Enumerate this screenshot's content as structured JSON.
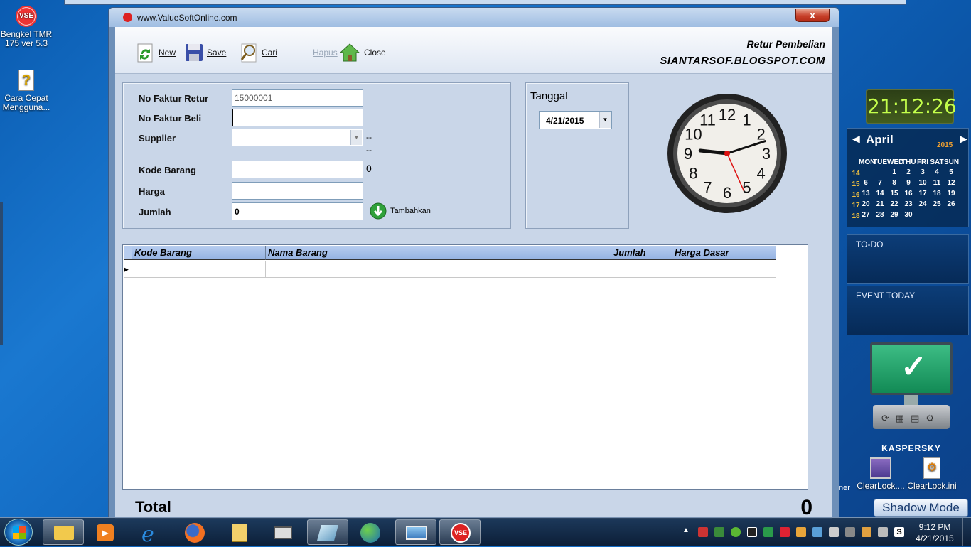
{
  "desktop": {
    "icons": [
      {
        "label": "Bengkel TMR 175 ver 5.3",
        "badge": "VSE"
      },
      {
        "label": "Cara Cepat Mengguna..."
      }
    ]
  },
  "window": {
    "title": "www.ValueSoftOnline.com",
    "close": "x"
  },
  "toolbar": {
    "new": "New",
    "save": "Save",
    "cari": "Cari",
    "hapus": "Hapus",
    "close": "Close",
    "title": "Retur Pembelian",
    "site": "SIANTARSOF.BLOGSPOT.COM"
  },
  "form": {
    "no_faktur_retur_label": "No Faktur Retur",
    "no_faktur_retur_value": "15000001",
    "no_faktur_beli_label": "No Faktur Beli",
    "no_faktur_beli_value": "",
    "supplier_label": "Supplier",
    "supplier_dash1": "--",
    "supplier_dash2": "--",
    "kode_barang_label": "Kode Barang",
    "kode_barang_side": "0",
    "harga_label": "Harga",
    "jumlah_label": "Jumlah",
    "jumlah_value": "0",
    "tambahkan": "Tambahkan"
  },
  "tanggal": {
    "label": "Tanggal",
    "value": "4/21/2015"
  },
  "grid": {
    "columns": [
      "Kode Barang",
      "Nama Barang",
      "Jumlah",
      "Harga Dasar"
    ]
  },
  "total": {
    "label": "Total",
    "value": "0"
  },
  "analog_clock": {
    "numbers": [
      "12",
      "1",
      "2",
      "3",
      "4",
      "5",
      "6",
      "7",
      "8",
      "9",
      "10",
      "11"
    ],
    "hour": 9.2,
    "minute": 12,
    "second": 26
  },
  "gadgets": {
    "digital_clock": "21:12:26",
    "calendar": {
      "month": "April",
      "year": "2015",
      "days": [
        "MON",
        "TUE",
        "WED",
        "THU",
        "FRI",
        "SAT",
        "SUN"
      ],
      "weeks": [
        {
          "wk": "14",
          "d": [
            "",
            "",
            "1",
            "2",
            "3",
            "4",
            "5"
          ]
        },
        {
          "wk": "15",
          "d": [
            "6",
            "7",
            "8",
            "9",
            "10",
            "11",
            "12"
          ]
        },
        {
          "wk": "16",
          "d": [
            "13",
            "14",
            "15",
            "16",
            "17",
            "18",
            "19"
          ]
        },
        {
          "wk": "17",
          "d": [
            "20",
            "21",
            "22",
            "23",
            "24",
            "25",
            "26"
          ]
        },
        {
          "wk": "18",
          "d": [
            "27",
            "28",
            "29",
            "30",
            "",
            "",
            ""
          ]
        }
      ]
    },
    "todo": "TO-DO",
    "event": "EVENT TODAY",
    "kaspersky": "KASPERSKY",
    "clearlock1": "ClearLock....",
    "clearlock2": "ClearLock.ini",
    "partial": "ner",
    "shadow_mode": "Shadow Mode"
  },
  "taskbar": {
    "time": "9:12 PM",
    "date": "4/21/2015"
  }
}
